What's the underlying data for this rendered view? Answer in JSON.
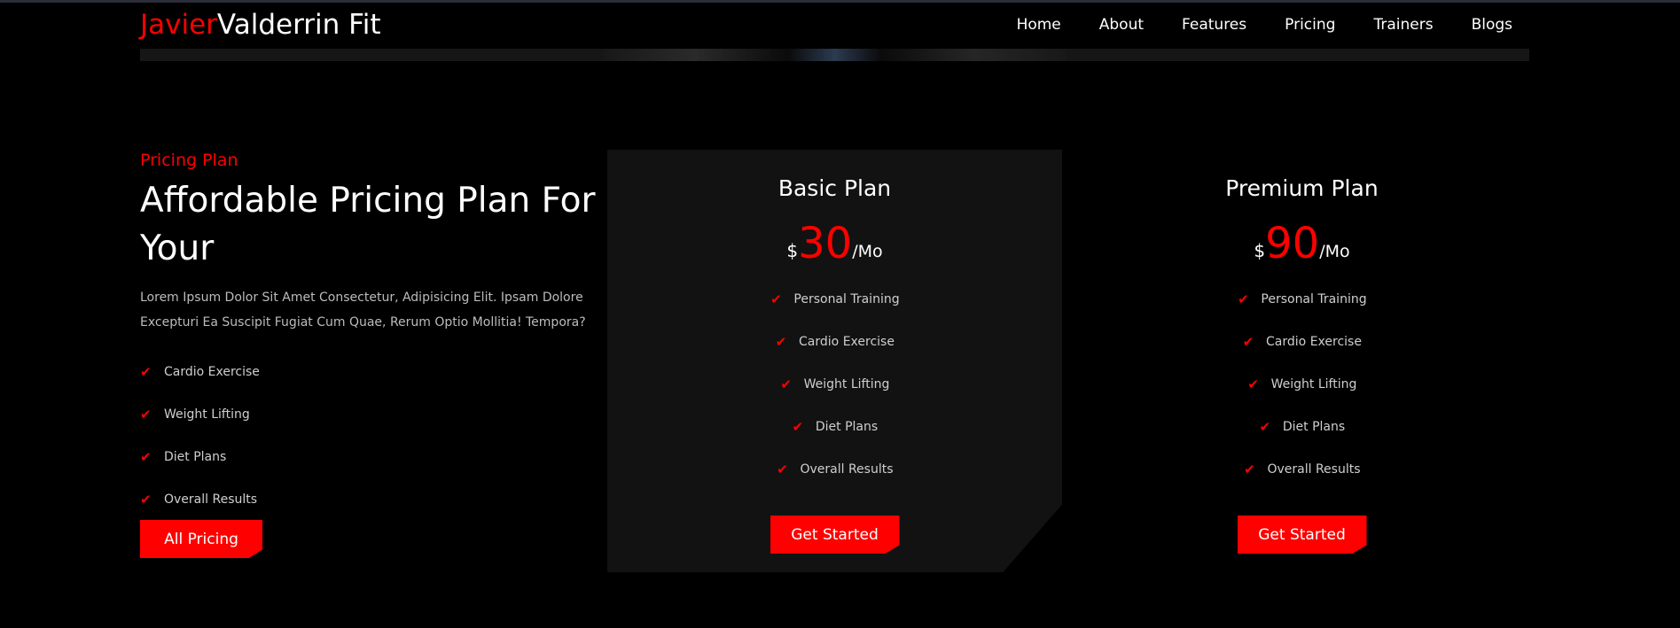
{
  "brand": {
    "first": "Javier",
    "second": "Valderrin Fit",
    "accent": "#ff0000"
  },
  "nav": [
    {
      "label": "Home"
    },
    {
      "label": "About"
    },
    {
      "label": "Features"
    },
    {
      "label": "Pricing"
    },
    {
      "label": "Trainers"
    },
    {
      "label": "Blogs"
    }
  ],
  "pricing": {
    "eyebrow": "Pricing Plan",
    "heading": "Affordable Pricing Plan For Your",
    "description": "Lorem Ipsum Dolor Sit Amet Consectetur, Adipisicing Elit. Ipsam Dolore Excepturi Ea Suscipit Fugiat Cum Quae, Rerum Optio Mollitia! Tempora?",
    "features": [
      "Cardio Exercise",
      "Weight Lifting",
      "Diet Plans",
      "Overall Results"
    ],
    "button": "All Pricing",
    "check_icon": "check-icon"
  },
  "plans": [
    {
      "name": "Basic Plan",
      "currency": "$",
      "amount": "30",
      "period": "/Mo",
      "features": [
        "Personal Training",
        "Cardio Exercise",
        "Weight Lifting",
        "Diet Plans",
        "Overall Results"
      ],
      "button": "Get Started"
    },
    {
      "name": "Premium Plan",
      "currency": "$",
      "amount": "90",
      "period": "/Mo",
      "features": [
        "Personal Training",
        "Cardio Exercise",
        "Weight Lifting",
        "Diet Plans",
        "Overall Results"
      ],
      "button": "Get Started"
    }
  ]
}
